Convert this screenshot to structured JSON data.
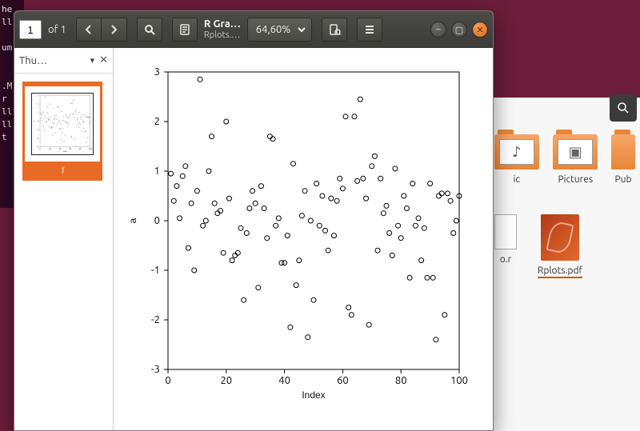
{
  "terminal_text": "he\nll\n \num\n \n \n.M\nr \nll\nll\nt",
  "files": {
    "items": [
      {
        "label": "ic",
        "icon": "music"
      },
      {
        "label": "Pictures",
        "icon": "pictures"
      },
      {
        "label": "Pub",
        "icon": "folder"
      }
    ],
    "items_row2": [
      {
        "label": "o.r",
        "icon": "text"
      },
      {
        "label": "Rplots.pdf",
        "icon": "pdf",
        "selected": true
      }
    ]
  },
  "viewer": {
    "page_current": "1",
    "page_total": "of 1",
    "title": "R Gra…",
    "subtitle": "Rplots.…",
    "zoom_label": "64,60%",
    "sidebar": {
      "mode_label": "Thu…",
      "thumb_number": "1"
    }
  },
  "chart_data": {
    "type": "scatter",
    "xlabel": "Index",
    "ylabel": "a",
    "xlim": [
      0,
      100
    ],
    "ylim": [
      -3,
      3
    ],
    "xticks": [
      0,
      20,
      40,
      60,
      80,
      100
    ],
    "yticks": [
      -3,
      -2,
      -1,
      0,
      1,
      2,
      3
    ],
    "x": [
      1,
      2,
      3,
      4,
      5,
      6,
      7,
      8,
      9,
      10,
      11,
      12,
      13,
      14,
      15,
      16,
      17,
      18,
      19,
      20,
      21,
      22,
      23,
      24,
      25,
      26,
      27,
      28,
      29,
      30,
      31,
      32,
      33,
      34,
      35,
      36,
      37,
      38,
      39,
      40,
      41,
      42,
      43,
      44,
      45,
      46,
      47,
      48,
      49,
      50,
      51,
      52,
      53,
      54,
      55,
      56,
      57,
      58,
      59,
      60,
      61,
      62,
      63,
      64,
      65,
      66,
      67,
      68,
      69,
      70,
      71,
      72,
      73,
      74,
      75,
      76,
      77,
      78,
      79,
      80,
      81,
      82,
      83,
      84,
      85,
      86,
      87,
      88,
      89,
      90,
      91,
      92,
      93,
      94,
      95,
      96,
      97,
      98,
      99,
      100
    ],
    "y": [
      0.95,
      0.4,
      0.7,
      0.05,
      0.9,
      1.1,
      -0.55,
      0.35,
      -1.0,
      0.6,
      2.85,
      -0.1,
      0.0,
      1.0,
      1.7,
      0.35,
      0.15,
      0.2,
      -0.65,
      2.0,
      0.45,
      -0.8,
      -0.7,
      -0.65,
      -0.15,
      -1.6,
      -0.25,
      0.25,
      0.6,
      0.35,
      -1.35,
      0.7,
      0.25,
      -0.35,
      1.7,
      1.65,
      -0.1,
      0.05,
      -0.85,
      -0.85,
      -0.3,
      -2.15,
      1.15,
      -1.3,
      -0.8,
      0.1,
      0.6,
      -2.35,
      0.0,
      -1.6,
      0.75,
      -0.1,
      0.5,
      -0.2,
      -0.6,
      0.45,
      -0.3,
      0.4,
      0.85,
      0.65,
      2.1,
      -1.75,
      -1.9,
      2.1,
      0.8,
      2.45,
      0.85,
      0.45,
      -2.1,
      1.1,
      1.3,
      -0.6,
      0.85,
      0.15,
      0.3,
      -0.25,
      -0.7,
      1.05,
      -0.1,
      -0.35,
      0.5,
      0.25,
      -1.15,
      0.75,
      -0.1,
      0.05,
      -0.8,
      -0.15,
      -1.15,
      0.75,
      -1.15,
      -2.4,
      0.5,
      0.55,
      -1.9,
      0.55,
      0.4,
      -0.25,
      0.0,
      0.5
    ]
  }
}
